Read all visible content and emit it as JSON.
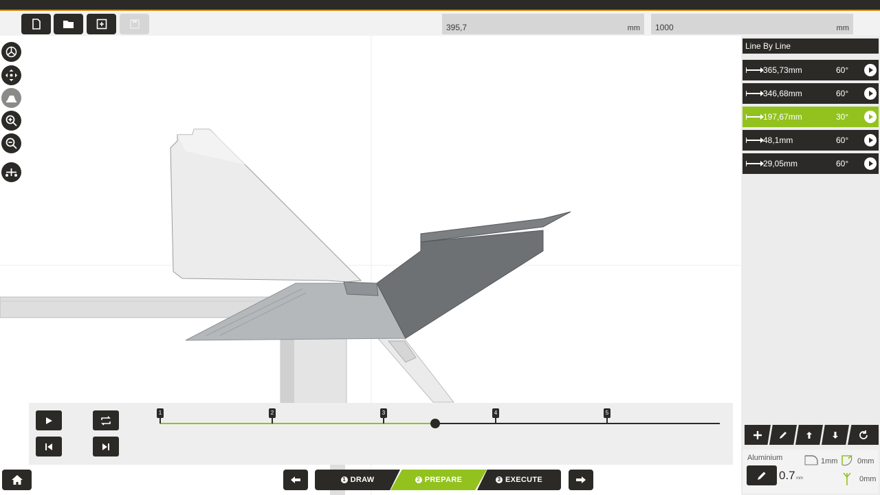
{
  "toolbar": {
    "buttons": [
      {
        "icon": "new-file-icon",
        "enabled": true
      },
      {
        "icon": "open-folder-icon",
        "enabled": true
      },
      {
        "icon": "save-as-icon",
        "enabled": true
      },
      {
        "icon": "save-icon",
        "enabled": false
      }
    ],
    "fields": [
      {
        "value": "395,7",
        "unit": "mm"
      },
      {
        "value": "1000",
        "unit": "mm"
      }
    ]
  },
  "side_tools": [
    "rotate-view-icon",
    "pan-icon",
    "tool-view-icon",
    "zoom-in-icon",
    "zoom-out-icon",
    "fit-view-icon"
  ],
  "panel": {
    "title": "Line By Line",
    "lines": [
      {
        "length": "365,73mm",
        "angle": "60°",
        "active": false
      },
      {
        "length": "346,68mm",
        "angle": "60°",
        "active": false
      },
      {
        "length": "197,67mm",
        "angle": "30°",
        "active": true
      },
      {
        "length": "48,1mm",
        "angle": "60°",
        "active": false
      },
      {
        "length": "29,05mm",
        "angle": "60°",
        "active": false
      }
    ],
    "tools": [
      "add-icon",
      "edit-icon",
      "move-up-icon",
      "move-down-icon",
      "refresh-icon"
    ]
  },
  "material": {
    "name": "Aluminium",
    "thickness": "0.7",
    "thickness_unit": "mm",
    "value_a": "1mm",
    "value_b": "0mm",
    "value_c": "0mm"
  },
  "player": {
    "steps": [
      "1",
      "2",
      "3",
      "4",
      "5"
    ],
    "progress": 0.5,
    "accent": "#93c21f"
  },
  "workflow": {
    "steps": [
      {
        "num": "1",
        "label": "DRAW"
      },
      {
        "num": "2",
        "label": "PREPARE"
      },
      {
        "num": "3",
        "label": "EXECUTE"
      }
    ],
    "active_step": 2
  }
}
